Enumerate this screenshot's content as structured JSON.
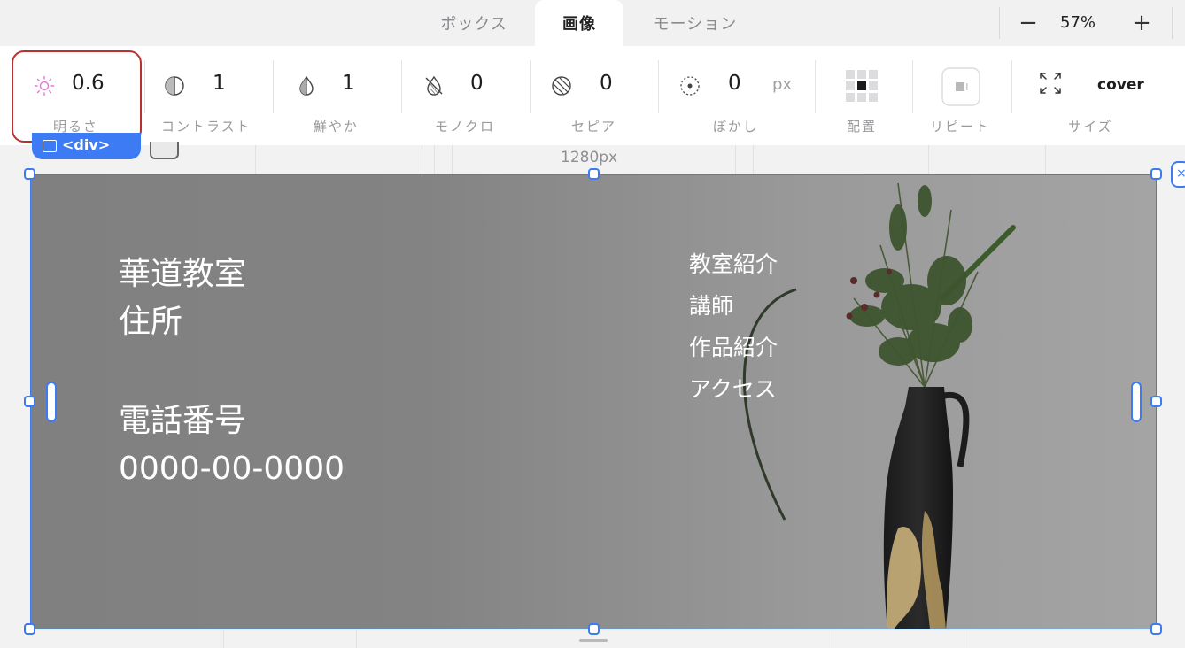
{
  "tabs": [
    {
      "label": "ボックス",
      "active": false
    },
    {
      "label": "画像",
      "active": true
    },
    {
      "label": "モーション",
      "active": false
    }
  ],
  "zoom": {
    "minus": "−",
    "value": "57%",
    "plus": "+"
  },
  "toolbar": {
    "brightness": {
      "value": "0.6",
      "label": "明るさ",
      "icon": "sun-icon"
    },
    "contrast": {
      "value": "1",
      "label": "コントラスト",
      "icon": "contrast-icon"
    },
    "saturation": {
      "value": "1",
      "label": "鮮やか",
      "icon": "saturation-drop-icon"
    },
    "grayscale": {
      "value": "0",
      "label": "モノクロ",
      "icon": "grayscale-drop-icon"
    },
    "sepia": {
      "value": "0",
      "label": "セピア",
      "icon": "sepia-icon"
    },
    "blur": {
      "value": "0",
      "unit": "px",
      "label": "ぼかし",
      "icon": "blur-icon"
    },
    "position": {
      "label": "配置",
      "icon": "position-grid-icon"
    },
    "repeat": {
      "label": "リピート",
      "icon": "repeat-icon"
    },
    "size": {
      "value": "cover",
      "label": "サイズ",
      "icon": "expand-icon"
    }
  },
  "canvas": {
    "width_label": "1280px",
    "element_badge": "<div>"
  },
  "hero": {
    "title": "華道教室",
    "address": "住所",
    "phone_label": "電話番号",
    "phone": "0000-00-0000",
    "nav": [
      "教室紹介",
      "講師",
      "作品紹介",
      "アクセス"
    ]
  },
  "colors": {
    "accent": "#3d7bf5",
    "highlight": "#b8312f",
    "brightness_icon": "#e07ad0"
  }
}
